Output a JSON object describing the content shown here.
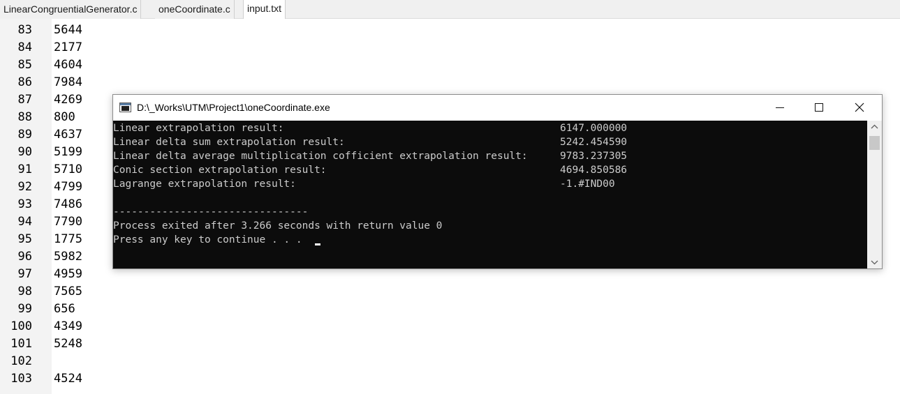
{
  "editor": {
    "tabs": [
      {
        "label": "LinearCongruentialGenerator.c",
        "active": false
      },
      {
        "label": "oneCoordinate.c",
        "active": false
      },
      {
        "label": "input.txt",
        "active": true
      }
    ],
    "lines": [
      {
        "num": "83",
        "text": "5644"
      },
      {
        "num": "84",
        "text": "2177"
      },
      {
        "num": "85",
        "text": "4604"
      },
      {
        "num": "86",
        "text": "7984"
      },
      {
        "num": "87",
        "text": "4269"
      },
      {
        "num": "88",
        "text": "800"
      },
      {
        "num": "89",
        "text": "4637"
      },
      {
        "num": "90",
        "text": "5199"
      },
      {
        "num": "91",
        "text": "5710"
      },
      {
        "num": "92",
        "text": "4799"
      },
      {
        "num": "93",
        "text": "7486"
      },
      {
        "num": "94",
        "text": "7790"
      },
      {
        "num": "95",
        "text": "1775"
      },
      {
        "num": "96",
        "text": "5982"
      },
      {
        "num": "97",
        "text": "4959"
      },
      {
        "num": "98",
        "text": "7565"
      },
      {
        "num": "99",
        "text": "656"
      },
      {
        "num": "100",
        "text": "4349"
      },
      {
        "num": "101",
        "text": "5248"
      },
      {
        "num": "102",
        "text": ""
      },
      {
        "num": "103",
        "text": "4524"
      }
    ]
  },
  "console": {
    "title": "D:\\_Works\\UTM\\Project1\\oneCoordinate.exe",
    "results": [
      {
        "label": "Linear extrapolation result:",
        "value": "6147.000000"
      },
      {
        "label": "Linear delta sum extrapolation result:",
        "value": "5242.454590"
      },
      {
        "label": "Linear delta average multiplication cofficient extrapolation result:",
        "value": "9783.237305"
      },
      {
        "label": "Conic section extrapolation result:",
        "value": "4694.850586"
      },
      {
        "label": "Lagrange extrapolation result:",
        "value": "-1.#IND00"
      }
    ],
    "separator": "--------------------------------",
    "exit_message": "Process exited after 3.266 seconds with return value 0",
    "prompt": "Press any key to continue . . . "
  },
  "colors": {
    "console_background": "#0c0c0c",
    "console_text": "#cccccc",
    "gutter_background": "#f3f3f3"
  },
  "icons": {
    "console_app": "console-window-icon",
    "minimize": "minimize-icon",
    "maximize": "maximize-icon",
    "close": "close-icon"
  }
}
